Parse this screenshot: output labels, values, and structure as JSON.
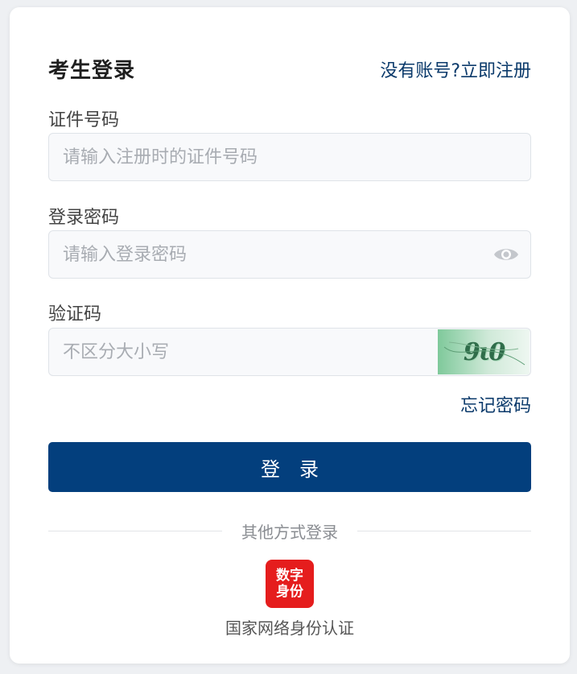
{
  "form": {
    "title": "考生登录",
    "register_link": "没有账号?立即注册",
    "id_label": "证件号码",
    "id_placeholder": "请输入注册时的证件号码",
    "password_label": "登录密码",
    "password_placeholder": "请输入登录密码",
    "captcha_label": "验证码",
    "captcha_placeholder": "不区分大小写",
    "captcha_text": "9ι0",
    "forgot_link": "忘记密码",
    "login_button": "登录"
  },
  "other_login": {
    "divider_text": "其他方式登录",
    "logo_line1": "数字",
    "logo_line2": "身份",
    "label": "国家网络身份认证"
  },
  "colors": {
    "primary": "#033f7d",
    "link": "#0b3a6b",
    "logo_red": "#e51d1d"
  }
}
